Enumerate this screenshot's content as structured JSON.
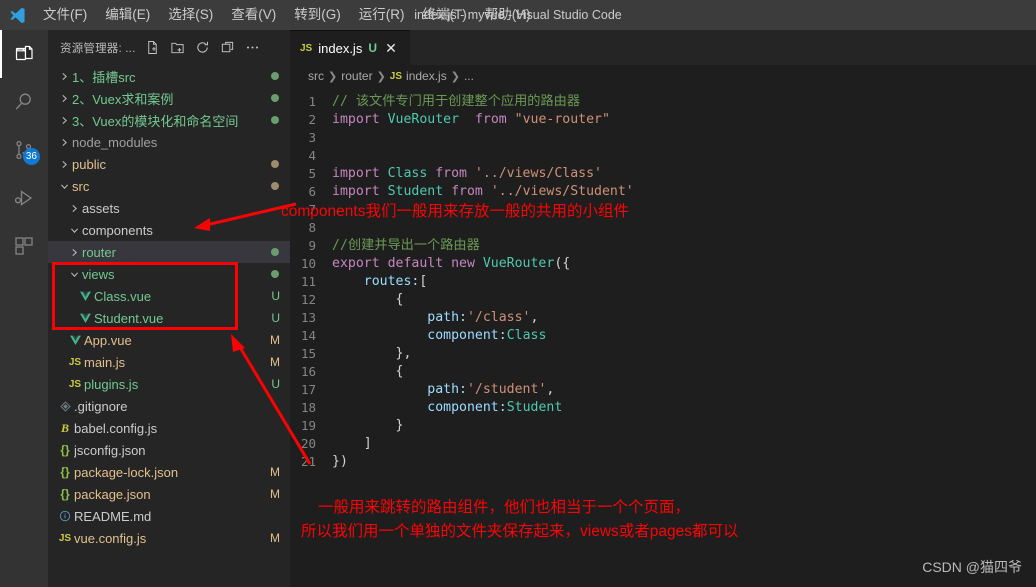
{
  "titlebar": {
    "logo_icon": "vscode-logo-icon",
    "window_title": "index.js - myvue - Visual Studio Code",
    "menus": [
      {
        "label": "文件(F)"
      },
      {
        "label": "编辑(E)"
      },
      {
        "label": "选择(S)"
      },
      {
        "label": "查看(V)"
      },
      {
        "label": "转到(G)"
      },
      {
        "label": "运行(R)"
      },
      {
        "label": "终端(T)"
      },
      {
        "label": "帮助(H)"
      }
    ]
  },
  "activitybar": {
    "items": [
      {
        "icon": "files-explorer-icon",
        "active": true,
        "badge": ""
      },
      {
        "icon": "search-icon",
        "active": false,
        "badge": ""
      },
      {
        "icon": "source-control-icon",
        "active": false,
        "badge": "36"
      },
      {
        "icon": "run-and-debug-icon",
        "active": false,
        "badge": ""
      },
      {
        "icon": "extensions-icon",
        "active": false,
        "badge": ""
      }
    ]
  },
  "sidebar": {
    "title": "资源管理器: ...",
    "actions": [
      {
        "icon": "new-file-icon"
      },
      {
        "icon": "new-folder-icon"
      },
      {
        "icon": "refresh-icon"
      },
      {
        "icon": "collapse-all-icon"
      },
      {
        "icon": "more-actions-icon"
      }
    ],
    "tree": [
      {
        "label": "1、插槽src",
        "indent": 0,
        "kind": "folder",
        "expanded": false,
        "color": "green",
        "status": "",
        "dot": "green",
        "icon": ""
      },
      {
        "label": "2、Vuex求和案例",
        "indent": 0,
        "kind": "folder",
        "expanded": false,
        "color": "green",
        "status": "",
        "dot": "green",
        "icon": ""
      },
      {
        "label": "3、Vuex的模块化和命名空间",
        "indent": 0,
        "kind": "folder",
        "expanded": false,
        "color": "green",
        "status": "",
        "dot": "green",
        "icon": ""
      },
      {
        "label": "node_modules",
        "indent": 0,
        "kind": "folder",
        "expanded": false,
        "color": "gray",
        "status": "",
        "dot": "",
        "icon": ""
      },
      {
        "label": "public",
        "indent": 0,
        "kind": "folder",
        "expanded": false,
        "color": "yellow",
        "status": "",
        "dot": "yellow",
        "icon": ""
      },
      {
        "label": "src",
        "indent": 0,
        "kind": "folder",
        "expanded": true,
        "color": "yellow",
        "status": "",
        "dot": "yellow",
        "icon": ""
      },
      {
        "label": "assets",
        "indent": 1,
        "kind": "folder",
        "expanded": false,
        "color": "white",
        "status": "",
        "dot": "",
        "icon": ""
      },
      {
        "label": "components",
        "indent": 1,
        "kind": "folder",
        "expanded": true,
        "color": "white",
        "status": "",
        "dot": "",
        "icon": ""
      },
      {
        "label": "router",
        "indent": 1,
        "kind": "folder",
        "expanded": false,
        "color": "green",
        "status": "",
        "dot": "green",
        "icon": "",
        "selected": true
      },
      {
        "label": "views",
        "indent": 1,
        "kind": "folder",
        "expanded": true,
        "color": "green",
        "status": "",
        "dot": "green",
        "icon": ""
      },
      {
        "label": "Class.vue",
        "indent": 2,
        "kind": "file",
        "color": "green",
        "status": "U",
        "status_color": "green",
        "icon": "vue-icon"
      },
      {
        "label": "Student.vue",
        "indent": 2,
        "kind": "file",
        "color": "green",
        "status": "U",
        "status_color": "green",
        "icon": "vue-icon"
      },
      {
        "label": "App.vue",
        "indent": 1,
        "kind": "file",
        "color": "yellow",
        "status": "M",
        "status_color": "yellow",
        "icon": "vue-icon"
      },
      {
        "label": "main.js",
        "indent": 1,
        "kind": "file",
        "color": "yellow",
        "status": "M",
        "status_color": "yellow",
        "icon": "js-icon"
      },
      {
        "label": "plugins.js",
        "indent": 1,
        "kind": "file",
        "color": "green",
        "status": "U",
        "status_color": "green",
        "icon": "js-icon"
      },
      {
        "label": ".gitignore",
        "indent": 0,
        "kind": "file",
        "color": "white",
        "status": "",
        "icon": "gitignore-icon"
      },
      {
        "label": "babel.config.js",
        "indent": 0,
        "kind": "file",
        "color": "white",
        "status": "",
        "icon": "babel-icon"
      },
      {
        "label": "jsconfig.json",
        "indent": 0,
        "kind": "file",
        "color": "white",
        "status": "",
        "icon": "json-icon"
      },
      {
        "label": "package-lock.json",
        "indent": 0,
        "kind": "file",
        "color": "yellow",
        "status": "M",
        "status_color": "yellow",
        "icon": "json-icon"
      },
      {
        "label": "package.json",
        "indent": 0,
        "kind": "file",
        "color": "yellow",
        "status": "M",
        "status_color": "yellow",
        "icon": "json-icon"
      },
      {
        "label": "README.md",
        "indent": 0,
        "kind": "file",
        "color": "white",
        "status": "",
        "icon": "info-icon"
      },
      {
        "label": "vue.config.js",
        "indent": 0,
        "kind": "file",
        "color": "yellow",
        "status": "M",
        "status_color": "yellow",
        "icon": "js-icon"
      }
    ]
  },
  "editor": {
    "tab": {
      "icon": "js-icon",
      "name": "index.js",
      "git_status": "U",
      "close_icon": "close-icon"
    },
    "breadcrumb": [
      "src",
      "router",
      "index.js",
      "..."
    ],
    "lines": [
      {
        "n": "1",
        "tokens": [
          {
            "t": "// 该文件专门用于创建整个应用的路由器",
            "c": "comment"
          }
        ]
      },
      {
        "n": "2",
        "tokens": [
          {
            "t": "import ",
            "c": "kw"
          },
          {
            "t": "VueRouter",
            "c": "cls"
          },
          {
            "t": "  ",
            "c": "plain"
          },
          {
            "t": "from ",
            "c": "kw"
          },
          {
            "t": "\"vue-router\"",
            "c": "str"
          }
        ]
      },
      {
        "n": "3",
        "tokens": []
      },
      {
        "n": "4",
        "tokens": []
      },
      {
        "n": "5",
        "tokens": [
          {
            "t": "import ",
            "c": "kw"
          },
          {
            "t": "Class ",
            "c": "cls"
          },
          {
            "t": "from ",
            "c": "kw"
          },
          {
            "t": "'../views/Class'",
            "c": "str"
          }
        ]
      },
      {
        "n": "6",
        "tokens": [
          {
            "t": "import ",
            "c": "kw"
          },
          {
            "t": "Student ",
            "c": "cls"
          },
          {
            "t": "from ",
            "c": "kw"
          },
          {
            "t": "'../views/Student'",
            "c": "str"
          }
        ]
      },
      {
        "n": "7",
        "tokens": []
      },
      {
        "n": "8",
        "tokens": []
      },
      {
        "n": "9",
        "tokens": [
          {
            "t": "//创建并导出一个路由器",
            "c": "comment"
          }
        ]
      },
      {
        "n": "10",
        "tokens": [
          {
            "t": "export default ",
            "c": "kw"
          },
          {
            "t": "new ",
            "c": "kw"
          },
          {
            "t": "VueRouter",
            "c": "cls"
          },
          {
            "t": "({",
            "c": "punc"
          }
        ]
      },
      {
        "n": "11",
        "tokens": [
          {
            "t": "    ",
            "c": "plain"
          },
          {
            "t": "routes:",
            "c": "var"
          },
          {
            "t": "[",
            "c": "punc"
          }
        ]
      },
      {
        "n": "12",
        "tokens": [
          {
            "t": "        ",
            "c": "plain"
          },
          {
            "t": "{",
            "c": "punc"
          }
        ]
      },
      {
        "n": "13",
        "tokens": [
          {
            "t": "            ",
            "c": "plain"
          },
          {
            "t": "path:",
            "c": "var"
          },
          {
            "t": "'/class'",
            "c": "str"
          },
          {
            "t": ",",
            "c": "punc"
          }
        ]
      },
      {
        "n": "14",
        "tokens": [
          {
            "t": "            ",
            "c": "plain"
          },
          {
            "t": "component:",
            "c": "var"
          },
          {
            "t": "Class",
            "c": "cls"
          }
        ]
      },
      {
        "n": "15",
        "tokens": [
          {
            "t": "        ",
            "c": "plain"
          },
          {
            "t": "},",
            "c": "punc"
          }
        ]
      },
      {
        "n": "16",
        "tokens": [
          {
            "t": "        ",
            "c": "plain"
          },
          {
            "t": "{",
            "c": "punc"
          }
        ]
      },
      {
        "n": "17",
        "tokens": [
          {
            "t": "            ",
            "c": "plain"
          },
          {
            "t": "path:",
            "c": "var"
          },
          {
            "t": "'/student'",
            "c": "str"
          },
          {
            "t": ",",
            "c": "punc"
          }
        ]
      },
      {
        "n": "18",
        "tokens": [
          {
            "t": "            ",
            "c": "plain"
          },
          {
            "t": "component:",
            "c": "var"
          },
          {
            "t": "Student",
            "c": "cls"
          }
        ]
      },
      {
        "n": "19",
        "tokens": [
          {
            "t": "        ",
            "c": "plain"
          },
          {
            "t": "}",
            "c": "punc"
          }
        ]
      },
      {
        "n": "20",
        "tokens": [
          {
            "t": "    ",
            "c": "plain"
          },
          {
            "t": "]",
            "c": "punc"
          }
        ]
      },
      {
        "n": "21",
        "tokens": [
          {
            "t": "})",
            "c": "punc"
          }
        ]
      }
    ]
  },
  "annotations": {
    "color": "#ff0000",
    "components_note": "components我们一般用来存放一般的共用的小组件",
    "views_note_line1": "一般用来跳转的路由组件，他们也相当于一个个页面，",
    "views_note_line2": "所以我们用一个单独的文件夹保存起来，views或者pages都可以"
  },
  "watermark": "CSDN @猫四爷"
}
